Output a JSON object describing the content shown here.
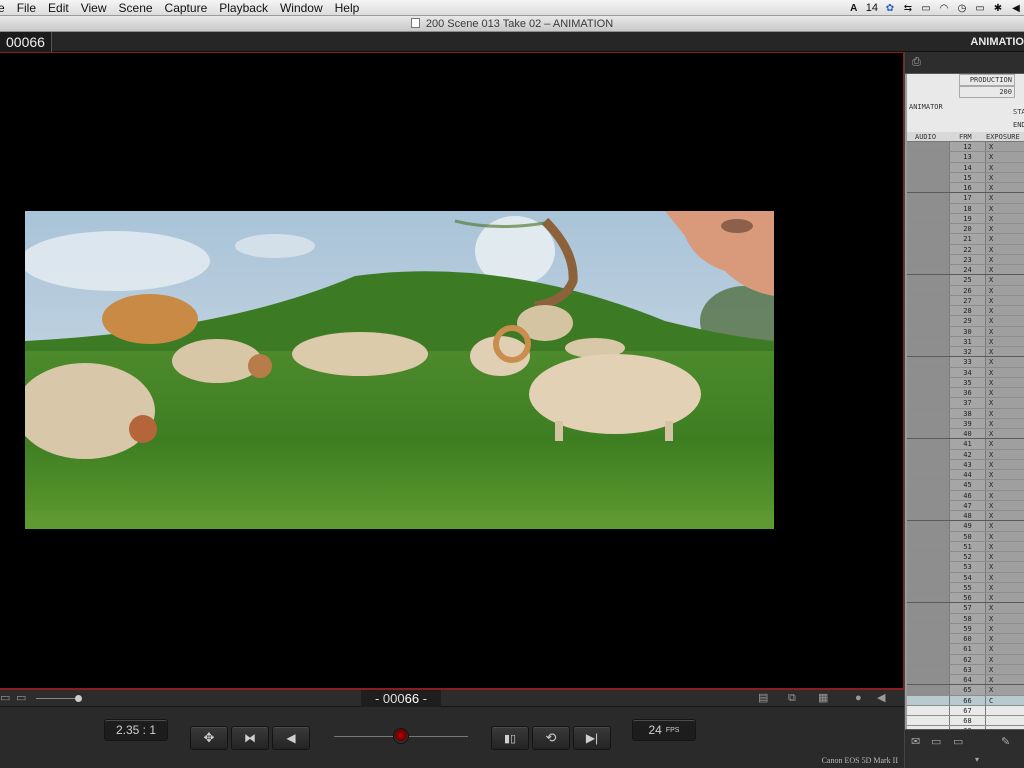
{
  "menubar": {
    "items": [
      "e",
      "File",
      "Edit",
      "View",
      "Scene",
      "Capture",
      "Playback",
      "Window",
      "Help"
    ],
    "status_text": "14"
  },
  "window": {
    "title": "200  Scene 013  Take 02 – ANIMATION"
  },
  "header": {
    "frame": "00066",
    "mode": "ANIMATIO"
  },
  "viewer": {
    "image_description_icon": "photo"
  },
  "bottom": {
    "counter_prefix": "- 000",
    "counter_value": "66",
    "counter_suffix": " -"
  },
  "controls": {
    "aspect": "2.35 : 1",
    "fps_value": "24",
    "fps_unit": "FPS",
    "camera": "Canon EOS 5D Mark II"
  },
  "xsheet": {
    "production_label": "PRODUCTION",
    "production_value": "200",
    "animator_label": "ANIMATOR",
    "start_label": "STA",
    "end_label": "END",
    "columns": {
      "audio": "AUDIO",
      "frame": "FRM",
      "exposure": "EXPOSURE"
    },
    "rows": [
      {
        "frame": "12",
        "mark": "X"
      },
      {
        "frame": "13",
        "mark": "X"
      },
      {
        "frame": "14",
        "mark": "X"
      },
      {
        "frame": "15",
        "mark": "X"
      },
      {
        "frame": "16",
        "mark": "X"
      },
      {
        "frame": "17",
        "mark": "X"
      },
      {
        "frame": "18",
        "mark": "X"
      },
      {
        "frame": "19",
        "mark": "X"
      },
      {
        "frame": "20",
        "mark": "X"
      },
      {
        "frame": "21",
        "mark": "X"
      },
      {
        "frame": "22",
        "mark": "X"
      },
      {
        "frame": "23",
        "mark": "X"
      },
      {
        "frame": "24",
        "mark": "X"
      },
      {
        "frame": "25",
        "mark": "X"
      },
      {
        "frame": "26",
        "mark": "X"
      },
      {
        "frame": "27",
        "mark": "X"
      },
      {
        "frame": "28",
        "mark": "X"
      },
      {
        "frame": "29",
        "mark": "X"
      },
      {
        "frame": "30",
        "mark": "X"
      },
      {
        "frame": "31",
        "mark": "X"
      },
      {
        "frame": "32",
        "mark": "X"
      },
      {
        "frame": "33",
        "mark": "X"
      },
      {
        "frame": "34",
        "mark": "X"
      },
      {
        "frame": "35",
        "mark": "X"
      },
      {
        "frame": "36",
        "mark": "X"
      },
      {
        "frame": "37",
        "mark": "X"
      },
      {
        "frame": "38",
        "mark": "X"
      },
      {
        "frame": "39",
        "mark": "X"
      },
      {
        "frame": "40",
        "mark": "X"
      },
      {
        "frame": "41",
        "mark": "X"
      },
      {
        "frame": "42",
        "mark": "X"
      },
      {
        "frame": "43",
        "mark": "X"
      },
      {
        "frame": "44",
        "mark": "X"
      },
      {
        "frame": "45",
        "mark": "X"
      },
      {
        "frame": "46",
        "mark": "X"
      },
      {
        "frame": "47",
        "mark": "X"
      },
      {
        "frame": "48",
        "mark": "X"
      },
      {
        "frame": "49",
        "mark": "X"
      },
      {
        "frame": "50",
        "mark": "X"
      },
      {
        "frame": "51",
        "mark": "X"
      },
      {
        "frame": "52",
        "mark": "X"
      },
      {
        "frame": "53",
        "mark": "X"
      },
      {
        "frame": "54",
        "mark": "X"
      },
      {
        "frame": "55",
        "mark": "X"
      },
      {
        "frame": "56",
        "mark": "X"
      },
      {
        "frame": "57",
        "mark": "X"
      },
      {
        "frame": "58",
        "mark": "X"
      },
      {
        "frame": "59",
        "mark": "X"
      },
      {
        "frame": "60",
        "mark": "X"
      },
      {
        "frame": "61",
        "mark": "X"
      },
      {
        "frame": "62",
        "mark": "X"
      },
      {
        "frame": "63",
        "mark": "X"
      },
      {
        "frame": "64",
        "mark": "X"
      },
      {
        "frame": "65",
        "mark": "X"
      },
      {
        "frame": "66",
        "mark": "C"
      },
      {
        "frame": "67",
        "mark": ""
      },
      {
        "frame": "68",
        "mark": ""
      },
      {
        "frame": "69",
        "mark": ""
      }
    ]
  },
  "colors": {
    "accent_red": "#8a1d1d",
    "current_row": "#b8c9d0"
  }
}
